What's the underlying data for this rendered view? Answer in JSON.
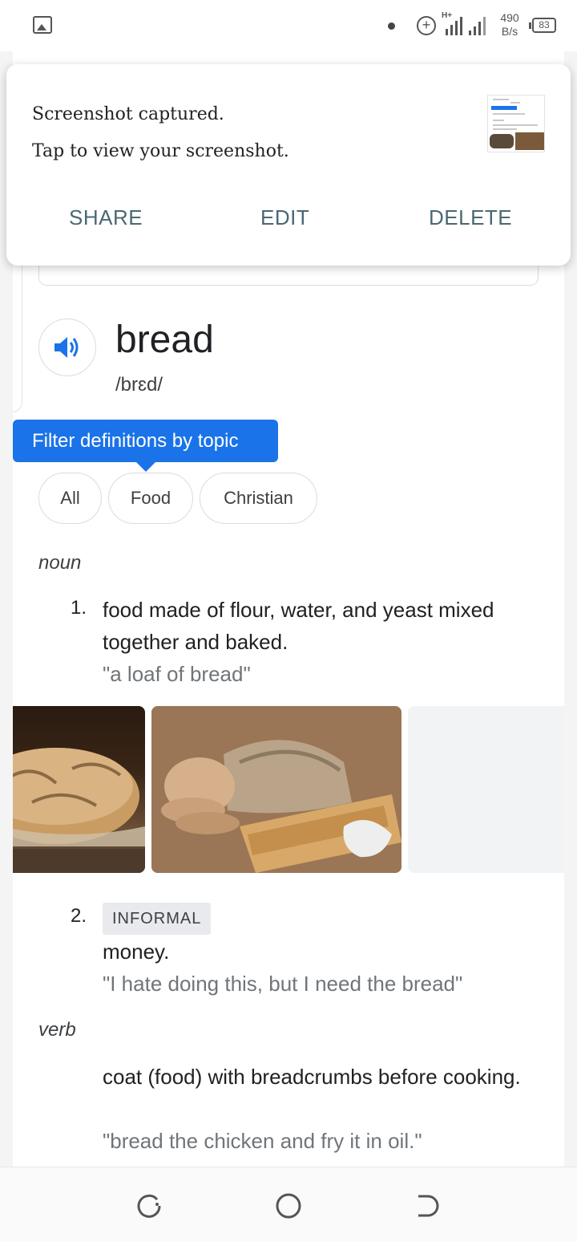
{
  "status_bar": {
    "network_speed_value": "490",
    "network_speed_unit": "B/s",
    "battery": "83",
    "icons": [
      "image-icon",
      "dot-icon",
      "plus-circle-icon",
      "signal-icon",
      "signal-icon",
      "battery-icon"
    ]
  },
  "notification": {
    "title": "Screenshot captured.",
    "subtitle": "Tap to view your screenshot.",
    "actions": {
      "share": "SHARE",
      "edit": "EDIT",
      "delete": "DELETE"
    },
    "action_color": "#4b6873"
  },
  "dictionary": {
    "word": "bread",
    "phonetic": "/brɛd/",
    "tooltip": "Filter definitions by topic",
    "topics": [
      "All",
      "Food",
      "Christian"
    ],
    "noun": {
      "label": "noun",
      "definitions": [
        {
          "number": "1.",
          "text": "food made of flour, water, and yeast mixed together and baked.",
          "example": "\"a loaf of bread\""
        },
        {
          "number": "2.",
          "register": "INFORMAL",
          "text": "money.",
          "example": "\"I hate doing this, but I need the bread\""
        }
      ]
    },
    "verb": {
      "label": "verb",
      "definition": {
        "text": "coat (food) with breadcrumbs before cooking.",
        "example": "\"bread the chicken and fry it in oil.\""
      }
    },
    "images": [
      "bread-loaf-image",
      "sliced-bread-image",
      "image-placeholder"
    ],
    "accent_color": "#1a73e8"
  },
  "nav_bar": {
    "icons": [
      "recents-icon",
      "home-icon",
      "back-icon"
    ]
  }
}
